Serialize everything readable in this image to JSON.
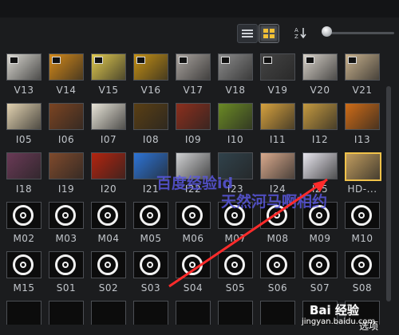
{
  "toolbar": {
    "icons": [
      "list-view-icon",
      "grid-view-icon",
      "sort-az-icon",
      "zoom-slider-icon"
    ],
    "sort_label": "A Z",
    "zoom_level": 0.1
  },
  "rows": [
    [
      "V13",
      "V14",
      "V15",
      "V16",
      "V17",
      "V18",
      "V19",
      "V20",
      "V21"
    ],
    [
      "I05",
      "I06",
      "I07",
      "I08",
      "I09",
      "I10",
      "I11",
      "I12",
      "I13"
    ],
    [
      "I18",
      "I19",
      "I20",
      "I21",
      "I22",
      "I23",
      "I24",
      "I25",
      "HD-..."
    ],
    [
      "M02",
      "M03",
      "M04",
      "M05",
      "M06",
      "M07",
      "M08",
      "M09",
      "M10"
    ],
    [
      "M15",
      "S01",
      "S02",
      "S03",
      "S04",
      "S05",
      "S06",
      "S07",
      "S08"
    ]
  ],
  "thumb_colors": [
    [
      "#d9d7d0",
      "#d58a1a",
      "#e0c94f",
      "#c49015",
      "#a9a39e",
      "#8c8c8c",
      "#444444",
      "#d7d1c8",
      "#c8b18d"
    ],
    [
      "#e2d2b0",
      "#7b4422",
      "#e8e4d8",
      "#5a3f14",
      "#8c2f1d",
      "#6b8a25",
      "#d6a13e",
      "#c59a40",
      "#cf6c17"
    ],
    [
      "#6a3a56",
      "#7f4a2c",
      "#b3240f",
      "#2d74d6",
      "#cfd0d2",
      "#30424b",
      "#d8a98c",
      "#e8e6ee",
      "#bf9b5e"
    ]
  ],
  "watermark": {
    "line1": "百度经验id",
    "line2": "天然河马啊相约"
  },
  "footer": {
    "baidu": "Bai 经验",
    "url": "jingyan.baidu.com",
    "partial": "选项"
  },
  "selected_tile": "HD-..."
}
